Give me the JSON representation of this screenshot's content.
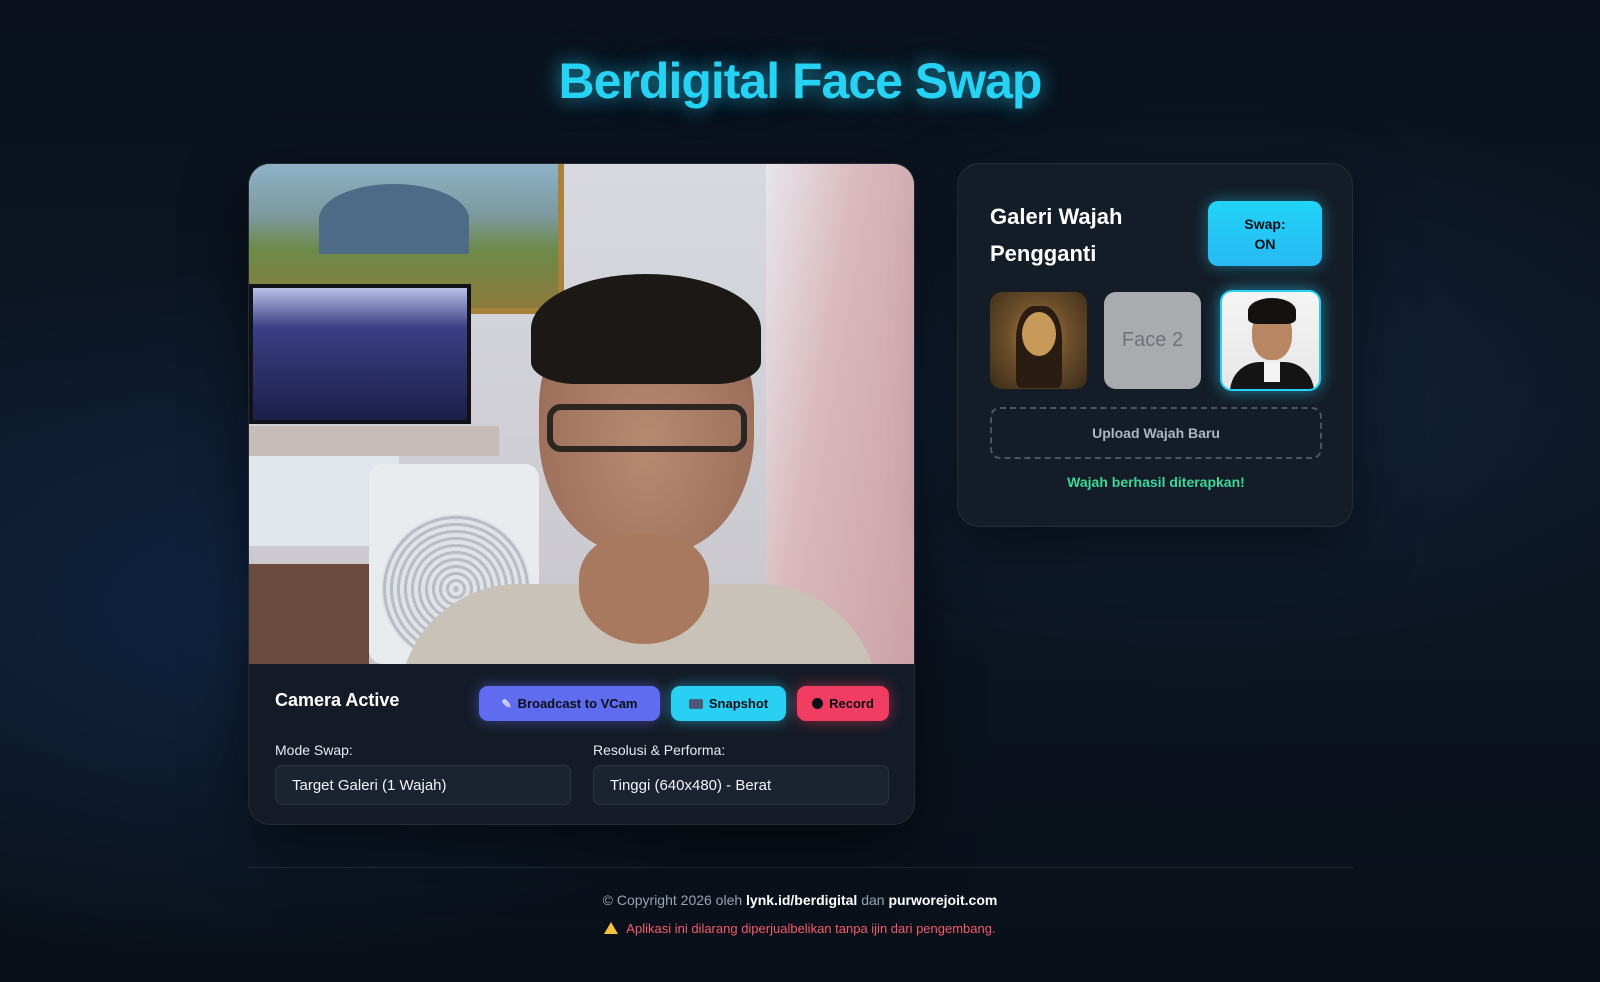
{
  "app": {
    "title": "Berdigital Face Swap"
  },
  "camera": {
    "status": "Camera Active",
    "buttons": {
      "broadcast_label": "Broadcast to VCam",
      "snapshot_label": "Snapshot",
      "record_label": "Record"
    },
    "mode_label": "Mode Swap:",
    "mode_value": "Target Galeri (1 Wajah)",
    "resolution_label": "Resolusi & Performa:",
    "resolution_value": "Tinggi (640x480) - Berat"
  },
  "gallery": {
    "title": "Galeri Wajah Pengganti",
    "swap_line1": "Swap:",
    "swap_line2": "ON",
    "faces": [
      {
        "label": "",
        "icon": "mona-lisa-portrait"
      },
      {
        "label": "Face 2",
        "icon": "placeholder"
      },
      {
        "label": "",
        "icon": "man-portrait",
        "selected": true
      }
    ],
    "upload_label": "Upload Wajah Baru",
    "status_message": "Wajah berhasil diterapkan!"
  },
  "footer": {
    "copyright_prefix": "© Copyright 2026 oleh",
    "link1": "lynk.id/berdigital",
    "joiner": "dan",
    "link2": "purworejoit.com",
    "warning": "Aplikasi ini dilarang diperjualbelikan tanpa ijin dari pengembang."
  },
  "colors": {
    "accent_cyan": "#27d3f5",
    "vcam_purple": "#5f6cf0",
    "record_red": "#f23d62",
    "success_green": "#3bd89a",
    "warning_red": "#f25c6d"
  }
}
